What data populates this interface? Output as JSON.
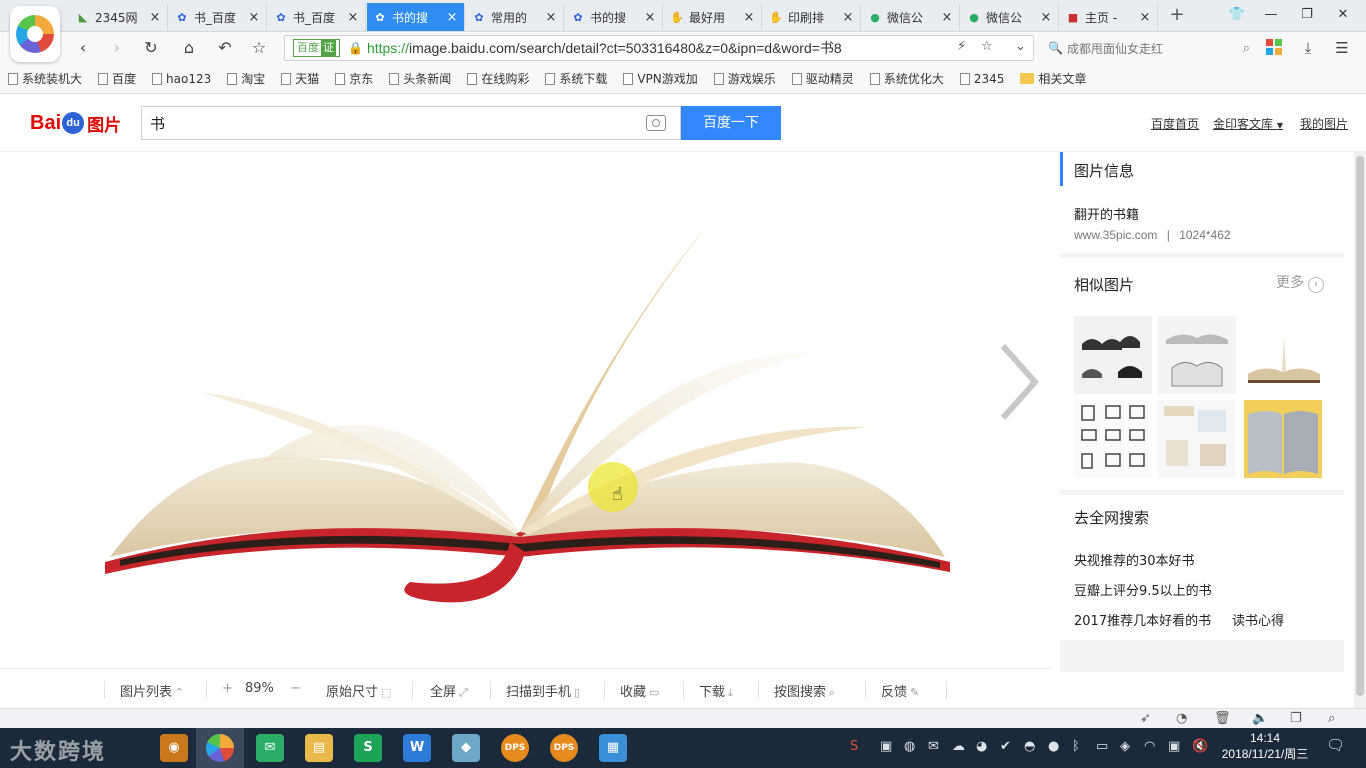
{
  "tabs": [
    {
      "label": "2345网",
      "icon": "2345"
    },
    {
      "label": "书_百度",
      "icon": "paw"
    },
    {
      "label": "书_百度",
      "icon": "paw"
    },
    {
      "label": "书的搜",
      "icon": "paw",
      "active": true
    },
    {
      "label": "常用的",
      "icon": "paw"
    },
    {
      "label": "书的搜",
      "icon": "paw"
    },
    {
      "label": "最好用",
      "icon": "hand"
    },
    {
      "label": "印刷排",
      "icon": "hand"
    },
    {
      "label": "微信公",
      "icon": "wechat"
    },
    {
      "label": "微信公",
      "icon": "wechat"
    },
    {
      "label": "主页 -",
      "icon": "home"
    }
  ],
  "tab_close": "×",
  "new_tab": "+",
  "address": {
    "badge": "百度",
    "badge_verified": "证",
    "url_scheme": "https://",
    "url_rest": "image.baidu.com/search/detail?ct=503316480&z=0&ipn=d&word=书8",
    "search_hint": "成都甩面仙女走红"
  },
  "bookmarks": [
    "系统装机大",
    "百度",
    "hao123",
    "淘宝",
    "天猫",
    "京东",
    "头条新闻",
    "在线购彩",
    "系统下载",
    "VPN游戏加",
    "游戏娱乐",
    "驱动精灵",
    "系统优化大",
    "2345",
    "相关文章"
  ],
  "baidu": {
    "logo_left": "Bai",
    "logo_paw": "du",
    "logo_right": "图片",
    "search_value": "书",
    "search_button": "百度一下",
    "links": [
      "百度首页",
      "金印客文库",
      "我的图片"
    ]
  },
  "viewer_toolbar": {
    "list": "图片列表",
    "zoom_in": "+",
    "zoom": "89%",
    "zoom_out": "−",
    "original": "原始尺寸",
    "fullscreen": "全屏",
    "scan": "扫描到手机",
    "collect": "收藏",
    "download": "下载",
    "search_by_image": "按图搜索",
    "feedback": "反馈"
  },
  "panel": {
    "info_title": "图片信息",
    "image_name": "翻开的书籍",
    "image_source": "www.35pic.com",
    "image_size": "1024*462",
    "similar_title": "相似图片",
    "more": "更多",
    "web_search_title": "去全网搜索",
    "web_links": [
      "央视推荐的30本好书",
      "豆瓣上评分9.5以上的书",
      "2017推荐几本好看的书",
      "读书心得"
    ]
  },
  "taskbar": {
    "watermark": "大数跨境",
    "apps": [
      "S",
      "W",
      "DPS",
      "DPS"
    ],
    "time": "14:14",
    "date": "2018/11/21/周三"
  },
  "colors": {
    "accent": "#3388ff",
    "active_tab": "#2f8df0",
    "baidu_red": "#e10601",
    "taskbar": "#1b2a3a"
  }
}
